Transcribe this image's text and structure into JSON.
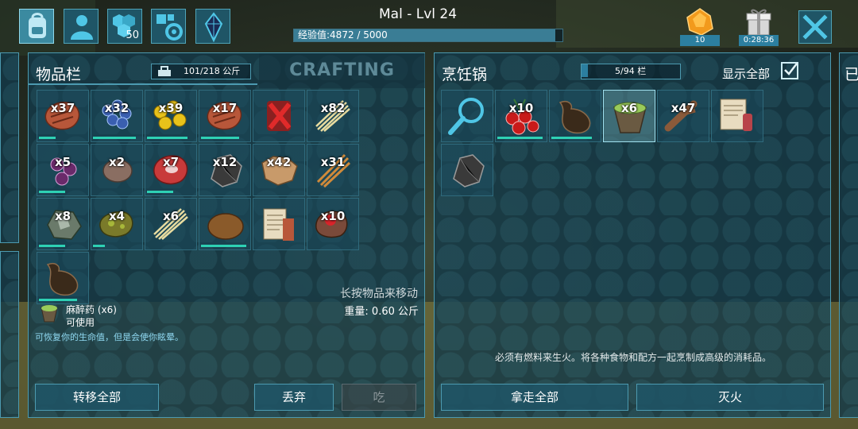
{
  "player": {
    "title": "Mal - Lvl 24",
    "xp_text": "经验值:4872 / 5000",
    "xp_fraction": 0.9744
  },
  "top_tabs": [
    {
      "icon": "backpack-icon",
      "active": true,
      "count": ""
    },
    {
      "icon": "character-icon",
      "active": false,
      "count": ""
    },
    {
      "icon": "tribe-icon",
      "active": false,
      "count": "50"
    },
    {
      "icon": "engram-settings-icon",
      "active": false,
      "count": ""
    },
    {
      "icon": "crystal-icon",
      "active": false,
      "count": ""
    }
  ],
  "currency": {
    "icon": "amber-icon",
    "count": "10"
  },
  "gift": {
    "icon": "gift-box-icon",
    "timer": "0:28:36"
  },
  "inventory": {
    "title": "物品栏",
    "weight": "101/218 公斤",
    "crafting_tab": "CRAFTING",
    "hint": "长按物品来移动",
    "slots": [
      {
        "icon": "cooked-meat-icon",
        "qty": "x37",
        "durability": 0.35
      },
      {
        "icon": "azulberry-icon",
        "qty": "x32",
        "durability": 0.9
      },
      {
        "icon": "amarberry-icon",
        "qty": "x39",
        "durability": 0.85
      },
      {
        "icon": "cooked-meat-icon",
        "qty": "x17",
        "durability": 0.8
      },
      {
        "icon": "bloodpack-icon",
        "qty": "",
        "durability": null
      },
      {
        "icon": "fiber-icon",
        "qty": "x82",
        "durability": null
      },
      {
        "icon": "narcoberry-icon",
        "qty": "x5",
        "durability": 0.55
      },
      {
        "icon": "stone-icon",
        "qty": "x2",
        "durability": null
      },
      {
        "icon": "raw-meat-icon",
        "qty": "x7",
        "durability": 0.55
      },
      {
        "icon": "flint-icon",
        "qty": "x12",
        "durability": null
      },
      {
        "icon": "hide-icon",
        "qty": "x42",
        "durability": null
      },
      {
        "icon": "thatch-icon",
        "qty": "x31",
        "durability": null
      },
      {
        "icon": "metal-ore-icon",
        "qty": "x8",
        "durability": 0.55
      },
      {
        "icon": "spoiled-meat-icon",
        "qty": "x4",
        "durability": 0.25
      },
      {
        "icon": "fiber-icon",
        "qty": "x6",
        "durability": null
      },
      {
        "icon": "kibble-icon",
        "qty": "",
        "durability": 0.95
      },
      {
        "icon": "notes-icon",
        "qty": "",
        "durability": null
      },
      {
        "icon": "rare-flower-icon",
        "qty": "x10",
        "durability": null
      },
      {
        "icon": "waterskin-icon",
        "qty": "",
        "durability": 0.8
      }
    ],
    "selected_item": {
      "icon": "narcotic-icon",
      "name": "麻醉药 (x6)",
      "state": "可使用",
      "weight": "重量: 0.60 公斤",
      "description": "可恢复你的生命值，但是会使你眩晕。"
    },
    "buttons": {
      "transfer_all": "转移全部",
      "drop": "丢弃",
      "eat": "吃"
    }
  },
  "cooking_pot": {
    "title": "烹饪锅",
    "fuel": "5/94 栏",
    "show_all_label": "显示全部",
    "show_all_checked": true,
    "slots": [
      {
        "icon": "search-icon",
        "qty": "",
        "durability": null,
        "selected": false
      },
      {
        "icon": "berries-icon",
        "qty": "x10",
        "durability": 0.95,
        "selected": false
      },
      {
        "icon": "waterskin-icon",
        "qty": "",
        "durability": 0.85,
        "selected": false
      },
      {
        "icon": "narcotic-icon",
        "qty": "x6",
        "durability": null,
        "selected": true
      },
      {
        "icon": "wood-icon",
        "qty": "x47",
        "durability": null,
        "selected": false
      },
      {
        "icon": "recipe-note-icon",
        "qty": "",
        "durability": null,
        "selected": false
      },
      {
        "icon": "flint-icon",
        "qty": "",
        "durability": null,
        "selected": false
      }
    ],
    "help": "必须有燃料来生火。将各种食物和配方一起烹制成高级的消耗品。",
    "buttons": {
      "take_all": "拿走全部",
      "extinguish": "灭火"
    }
  },
  "right_edge_title": "已"
}
